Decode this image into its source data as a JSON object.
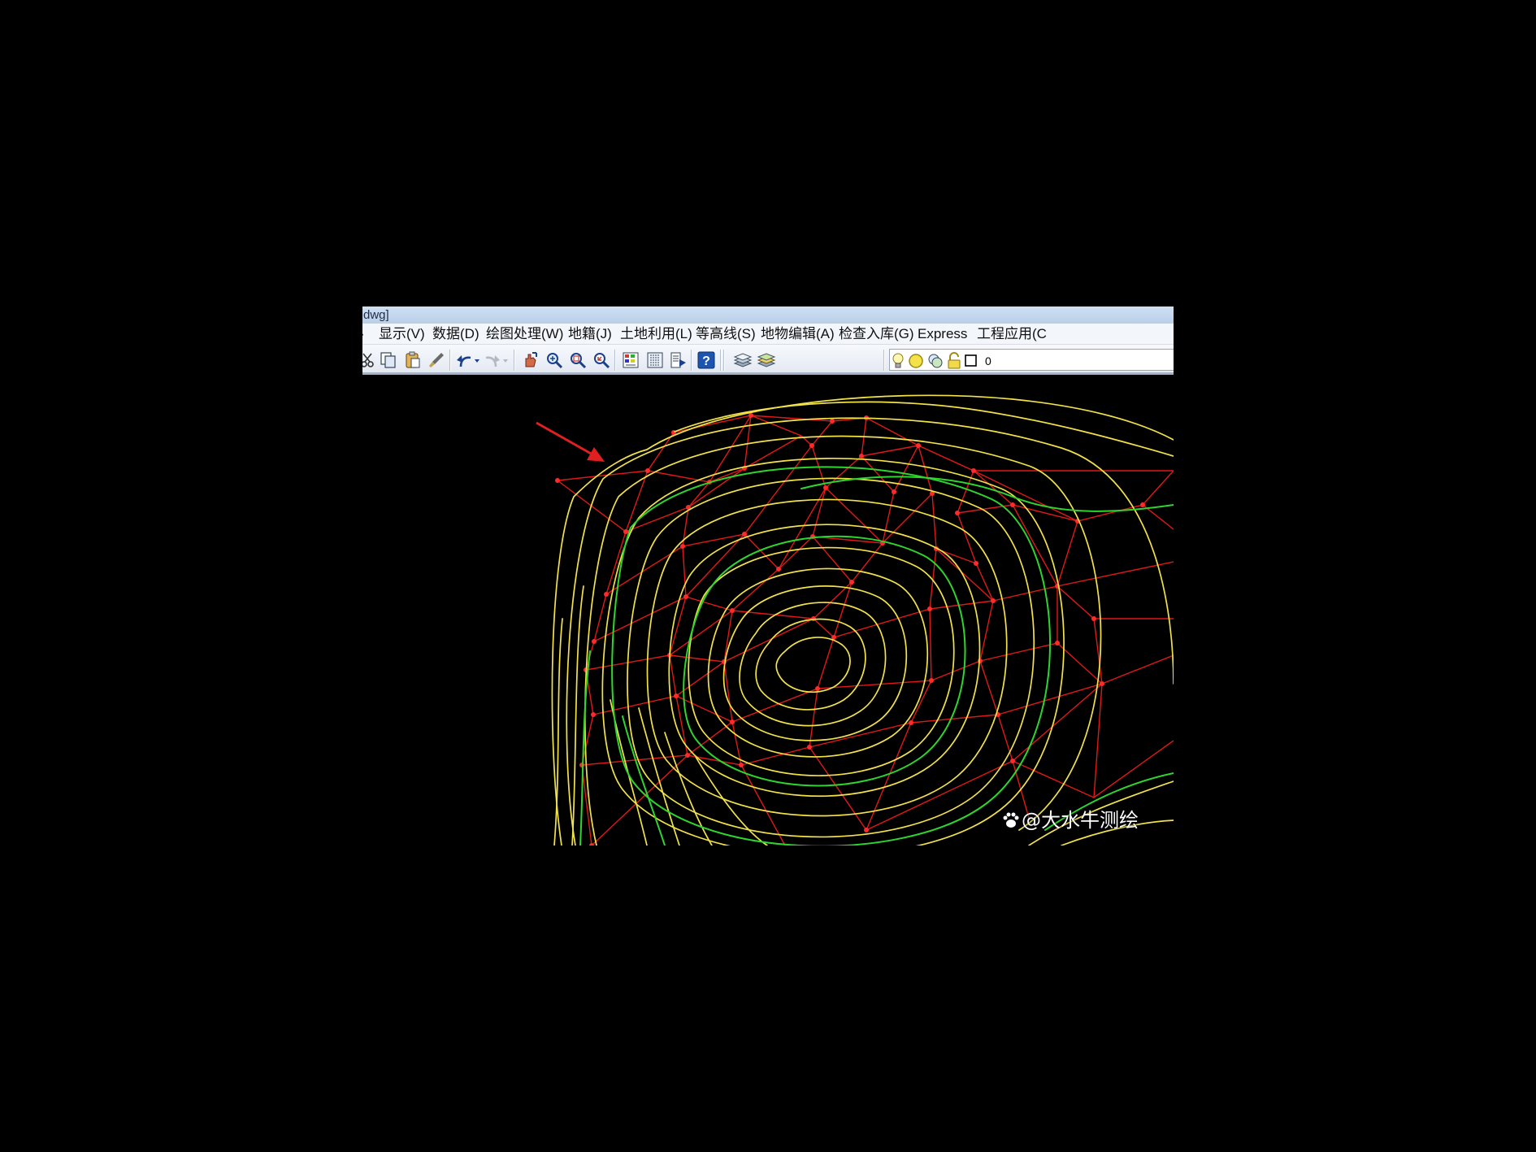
{
  "window": {
    "title_fragment": "dwg]"
  },
  "menu": {
    "items": [
      {
        "label": "显示(V)"
      },
      {
        "label": "数据(D)"
      },
      {
        "label": "绘图处理(W)"
      },
      {
        "label": "地籍(J)"
      },
      {
        "label": "土地利用(L)"
      },
      {
        "label": "等高线(S)"
      },
      {
        "label": "地物编辑(A)"
      },
      {
        "label": "检查入库(G)"
      },
      {
        "label": "Express"
      },
      {
        "label": "工程应用(C"
      }
    ]
  },
  "toolbar": {
    "icons": [
      "cut-icon",
      "copy-icon",
      "paste-icon",
      "match-properties-icon",
      "undo-icon",
      "redo-icon",
      "pan-icon",
      "zoom-realtime-icon",
      "zoom-window-icon",
      "zoom-previous-icon",
      "properties-icon",
      "design-center-icon",
      "tool-palette-icon",
      "help-icon",
      "layer-manager-icon",
      "layer-previous-icon",
      "light-bulb-icon",
      "sun-icon",
      "freeze-icon",
      "lock-icon",
      "color-swatch-icon"
    ],
    "current_layer": "0"
  },
  "drawing": {
    "colors": {
      "tin": "#e01818",
      "contour_minor": "#f2e24a",
      "contour_index": "#2ed52e",
      "arrow": "#e02020",
      "background": "#000000"
    }
  },
  "watermark": {
    "text": "@大水牛测绘"
  }
}
